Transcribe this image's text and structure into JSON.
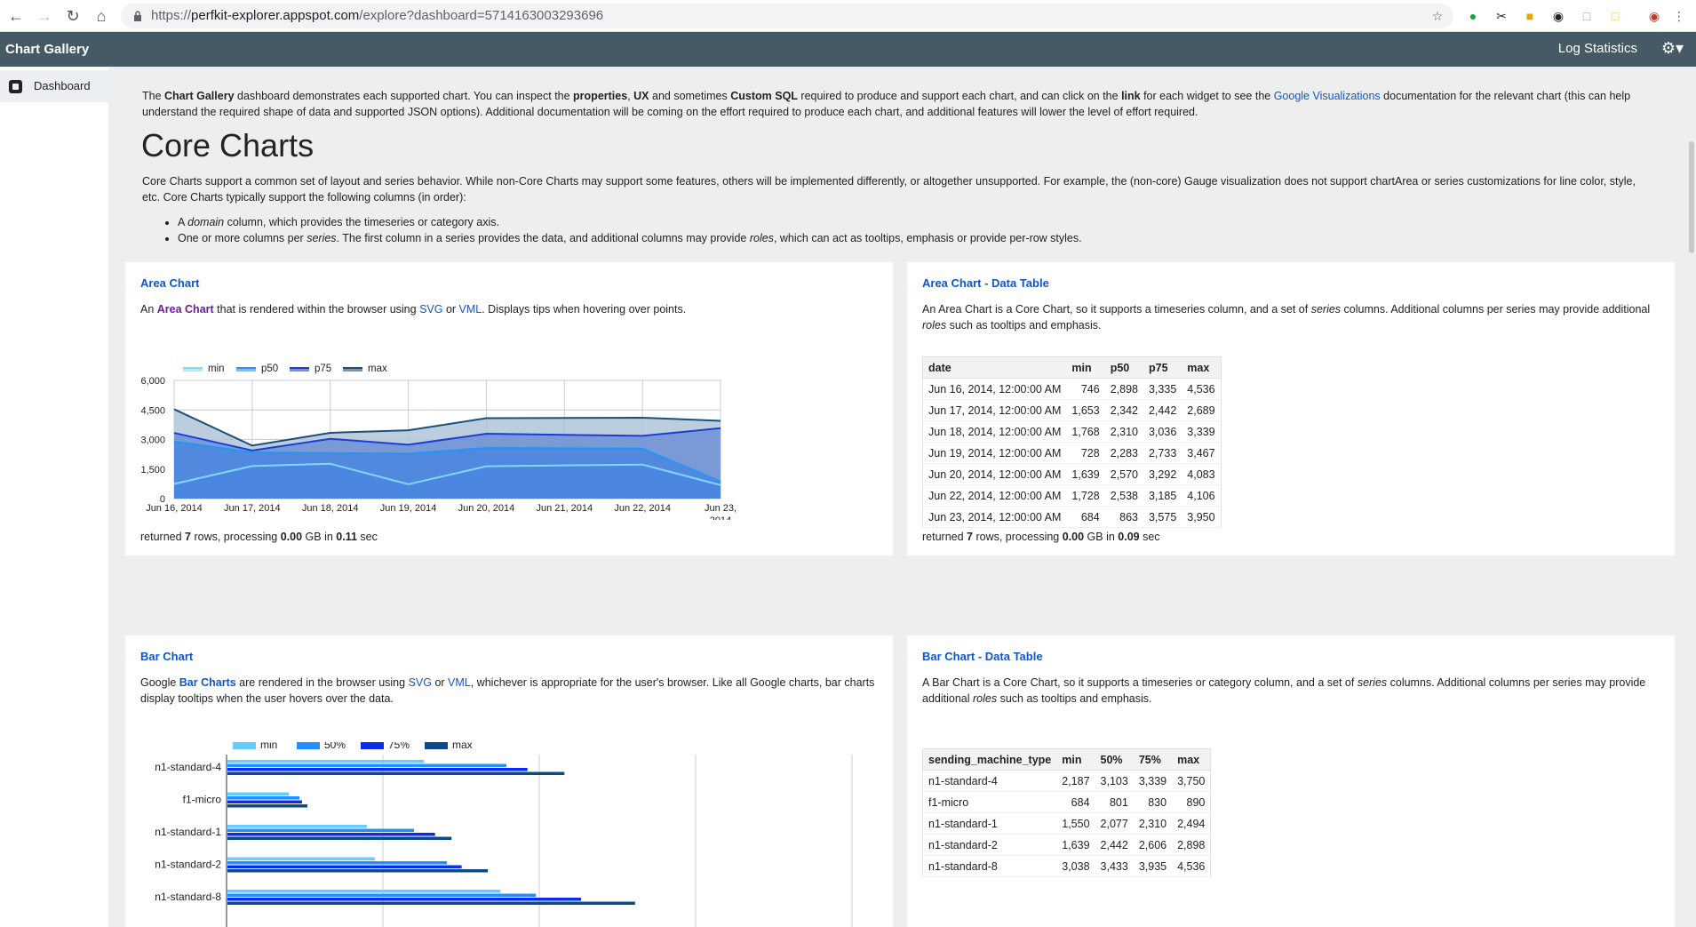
{
  "browser": {
    "url_prefix": "https://",
    "url_host": "perfkit-explorer.appspot.com",
    "url_path": "/explore?dashboard=5714163003293696"
  },
  "appbar": {
    "title": "Chart Gallery",
    "log_statistics": "Log Statistics"
  },
  "sidebar": {
    "items": [
      {
        "label": "Dashboard"
      }
    ]
  },
  "intro": {
    "p1": "The ",
    "b1": "Chart Gallery",
    "p2": " dashboard demonstrates each supported chart. You can inspect the ",
    "b2": "properties",
    "p3": ", ",
    "b3": "UX",
    "p4": " and sometimes ",
    "b4": "Custom SQL",
    "p5": " required to produce and support each chart, and can click on the ",
    "b5": "link",
    "p6": " for each widget to see the ",
    "link": "Google Visualizations",
    "p7": " documentation for the relevant chart (this can help understand the required shape of data and supported JSON options). Additional documentation will be coming on the effort required to produce each chart, and additional features will lower the level of effort required."
  },
  "core": {
    "heading": "Core Charts",
    "desc": "Core Charts support a common set of layout and series behavior. While non-Core Charts may support some features, others will be implemented differently, or altogether unsupported. For example, the (non-core) Gauge visualization does not support chartArea or series customizations for line color, style, etc. Core Charts typically support the following columns (in order):",
    "bullet1_a": "A ",
    "bullet1_em": "domain",
    "bullet1_b": " column, which provides the timeseries or category axis.",
    "bullet2_a": "One or more columns per ",
    "bullet2_em": "series",
    "bullet2_b": ". The first column in a series provides the data, and additional columns may provide ",
    "bullet2_em2": "roles",
    "bullet2_c": ", which can act as tooltips, emphasis or provide per-row styles."
  },
  "area_card": {
    "title": "Area Chart",
    "d1": "An ",
    "d_link": "Area Chart",
    "d2": " that is rendered within the browser using ",
    "svg": "SVG",
    "or": " or ",
    "vml": "VML",
    "d3": ". Displays tips when hovering over points.",
    "footer_a": "returned ",
    "rows": "7",
    "footer_b": " rows, processing ",
    "gb": "0.00",
    "footer_c": " GB in ",
    "sec": "0.11",
    "footer_d": " sec"
  },
  "area_table_card": {
    "title": "Area Chart - Data Table",
    "d1": "An Area Chart is a Core Chart, so it supports a timeseries column, and a set of ",
    "d_em": "series",
    "d2": " columns. Additional columns per series may provide additional ",
    "d_em2": "roles",
    "d3": " such as tooltips and emphasis.",
    "columns": [
      "date",
      "min",
      "p50",
      "p75",
      "max"
    ],
    "rows": [
      [
        "Jun 16, 2014, 12:00:00 AM",
        "746",
        "2,898",
        "3,335",
        "4,536"
      ],
      [
        "Jun 17, 2014, 12:00:00 AM",
        "1,653",
        "2,342",
        "2,442",
        "2,689"
      ],
      [
        "Jun 18, 2014, 12:00:00 AM",
        "1,768",
        "2,310",
        "3,036",
        "3,339"
      ],
      [
        "Jun 19, 2014, 12:00:00 AM",
        "728",
        "2,283",
        "2,733",
        "3,467"
      ],
      [
        "Jun 20, 2014, 12:00:00 AM",
        "1,639",
        "2,570",
        "3,292",
        "4,083"
      ],
      [
        "Jun 22, 2014, 12:00:00 AM",
        "1,728",
        "2,538",
        "3,185",
        "4,106"
      ],
      [
        "Jun 23, 2014, 12:00:00 AM",
        "684",
        "863",
        "3,575",
        "3,950"
      ]
    ],
    "footer_a": "returned ",
    "rows_count": "7",
    "footer_b": " rows, processing ",
    "gb": "0.00",
    "footer_c": " GB in ",
    "sec": "0.09",
    "footer_d": " sec"
  },
  "bar_card": {
    "title": "Bar Chart",
    "d1": "Google ",
    "d_link": "Bar Charts",
    "d2": " are rendered in the browser using ",
    "svg": "SVG",
    "or": " or ",
    "vml": "VML",
    "d3": ", whichever is appropriate for the user's browser. Like all Google charts, bar charts display tooltips when the user hovers over the data."
  },
  "bar_table_card": {
    "title": "Bar Chart - Data Table",
    "d1": "A Bar Chart is a Core Chart, so it supports a timeseries or category column, and a set of ",
    "d_em": "series",
    "d2": " columns. Additional columns per series may provide additional ",
    "d_em2": "roles",
    "d3": " such as tooltips and emphasis.",
    "columns": [
      "sending_machine_type",
      "min",
      "50%",
      "75%",
      "max"
    ],
    "rows": [
      [
        "n1-standard-4",
        "2,187",
        "3,103",
        "3,339",
        "3,750"
      ],
      [
        "f1-micro",
        "684",
        "801",
        "830",
        "890"
      ],
      [
        "n1-standard-1",
        "1,550",
        "2,077",
        "2,310",
        "2,494"
      ],
      [
        "n1-standard-2",
        "1,639",
        "2,442",
        "2,606",
        "2,898"
      ],
      [
        "n1-standard-8",
        "3,038",
        "3,433",
        "3,935",
        "4,536"
      ]
    ]
  },
  "chart_data": [
    {
      "type": "area",
      "title": "",
      "x": [
        "Jun 16, 2014",
        "Jun 17, 2014",
        "Jun 18, 2014",
        "Jun 19, 2014",
        "Jun 20, 2014",
        "Jun 22, 2014",
        "Jun 23, 2014"
      ],
      "x_tick_labels": [
        "Jun 16, 2014",
        "Jun 17, 2014",
        "Jun 18, 2014",
        "Jun 19, 2014",
        "Jun 20, 2014",
        "Jun 21, 2014",
        "Jun 22, 2014",
        "Jun 23,",
        "2014"
      ],
      "y_tick_labels": [
        "6,000",
        "4,500",
        "3,000",
        "1,500",
        "0"
      ],
      "ylim": [
        0,
        6000
      ],
      "legend_position": "top",
      "series": [
        {
          "name": "min",
          "color": "#80d8ff",
          "values": [
            746,
            1653,
            1768,
            728,
            1639,
            1728,
            684
          ]
        },
        {
          "name": "p50",
          "color": "#2196f3",
          "values": [
            2898,
            2342,
            2310,
            2283,
            2570,
            2538,
            863
          ]
        },
        {
          "name": "p75",
          "color": "#1a3fd6",
          "values": [
            3335,
            2442,
            3036,
            2733,
            3292,
            3185,
            3575
          ]
        },
        {
          "name": "max",
          "color": "#1c4f7a",
          "values": [
            4536,
            2689,
            3339,
            3467,
            4083,
            4106,
            3950
          ]
        }
      ]
    },
    {
      "type": "bar",
      "orientation": "horizontal",
      "title": "",
      "categories": [
        "n1-standard-4",
        "f1-micro",
        "n1-standard-1",
        "n1-standard-2",
        "n1-standard-8"
      ],
      "legend_position": "top",
      "xlim": [
        0,
        6000
      ],
      "series": [
        {
          "name": "min",
          "color": "#66ccff",
          "values": [
            2187,
            684,
            1550,
            1639,
            3038
          ]
        },
        {
          "name": "50%",
          "color": "#1e90ff",
          "values": [
            3103,
            801,
            2077,
            2442,
            3433
          ]
        },
        {
          "name": "75%",
          "color": "#0b2bf0",
          "values": [
            3339,
            830,
            2310,
            2606,
            3935
          ]
        },
        {
          "name": "max",
          "color": "#0a4a8a",
          "values": [
            3750,
            890,
            2494,
            2898,
            4536
          ]
        }
      ]
    }
  ]
}
